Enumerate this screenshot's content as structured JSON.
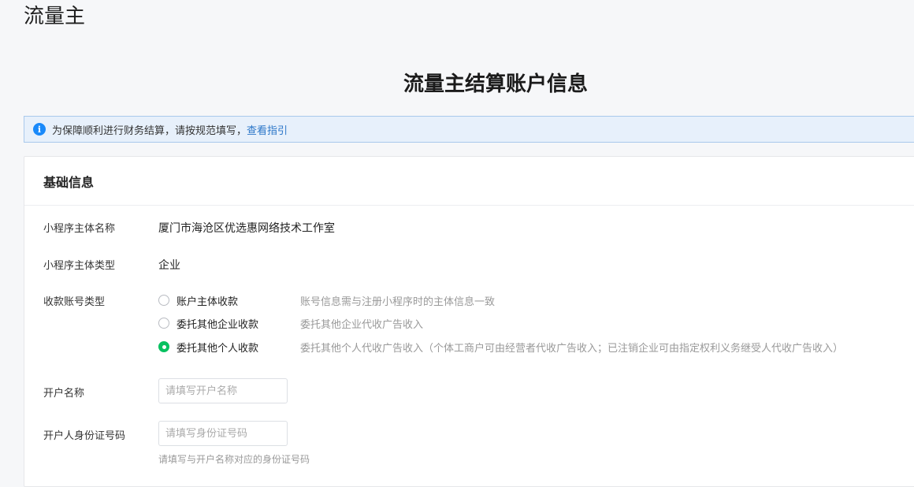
{
  "header": {
    "app_title": "流量主"
  },
  "page": {
    "title": "流量主结算账户信息"
  },
  "notice": {
    "icon": "info-icon",
    "text": "为保障顺利进行财务结算，请按规范填写，",
    "link": "查看指引"
  },
  "basic_info": {
    "section_title": "基础信息",
    "subject_name": {
      "label": "小程序主体名称",
      "value": "厦门市海沧区优选惠网络技术工作室"
    },
    "subject_type": {
      "label": "小程序主体类型",
      "value": "企业"
    },
    "account_type": {
      "label": "收款账号类型",
      "options": [
        {
          "label": "账户主体收款",
          "desc": "账号信息需与注册小程序时的主体信息一致",
          "checked": false
        },
        {
          "label": "委托其他企业收款",
          "desc": "委托其他企业代收广告收入",
          "checked": false
        },
        {
          "label": "委托其他个人收款",
          "desc": "委托其他个人代收广告收入（个体工商户可由经营者代收广告收入；已注销企业可由指定权利义务继受人代收广告收入）",
          "checked": true
        }
      ]
    },
    "account_name": {
      "label": "开户名称",
      "placeholder": "请填写开户名称",
      "value": ""
    },
    "id_number": {
      "label": "开户人身份证号码",
      "placeholder": "请填写身份证号码",
      "value": "",
      "hint": "请填写与开户名称对应的身份证号码"
    }
  },
  "colors": {
    "accent": "#07c160",
    "link": "#2b76c8",
    "info": "#1989fa"
  }
}
